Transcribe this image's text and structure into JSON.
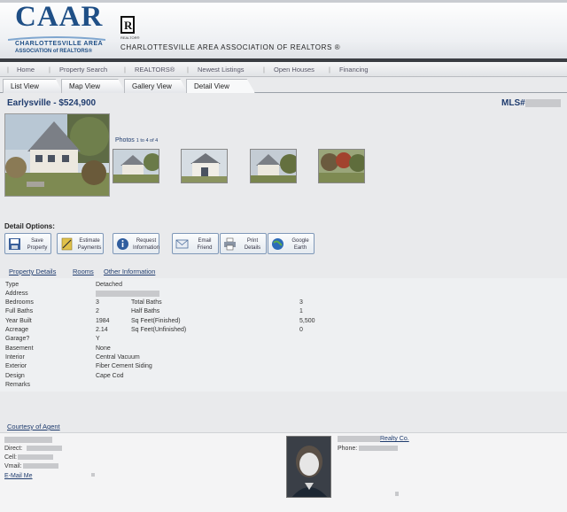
{
  "header": {
    "logo_text": "CAAR",
    "logo_line1": "CHARLOTTESVILLE AREA",
    "logo_line2": "ASSOCIATION of REALTORS®",
    "realtor_mark": "R",
    "realtor_small": "REALTOR®",
    "association_name": "CHARLOTTESVILLE AREA ASSOCIATION OF REALTORS ®"
  },
  "nav": {
    "items": [
      "Home",
      "Property Search",
      "REALTORS®",
      "Newest Listings",
      "Open Houses",
      "Financing"
    ]
  },
  "tabs": {
    "items": [
      "List View",
      "Map View",
      "Gallery View",
      "Detail View"
    ],
    "active": "Detail View"
  },
  "listing": {
    "title": "Earlysville - $524,900",
    "mls_label": "MLS#"
  },
  "photos": {
    "label": "Photos",
    "count_text": "1 to 4 of 4"
  },
  "detail_options": {
    "label": "Detail Options:",
    "buttons": [
      {
        "line1": "Save",
        "line2": "Property",
        "icon": "save-icon"
      },
      {
        "line1": "Estimate",
        "line2": "Payments",
        "icon": "calculator-icon"
      },
      {
        "line1": "Request",
        "line2": "Information",
        "icon": "info-icon"
      },
      {
        "line1": "Email",
        "line2": "Friend",
        "icon": "email-icon"
      },
      {
        "line1": "Print",
        "line2": "Details",
        "icon": "print-icon"
      },
      {
        "line1": "Google",
        "line2": "Earth",
        "icon": "globe-icon"
      }
    ]
  },
  "subtabs": [
    "Property Details",
    "Rooms",
    "Other Information"
  ],
  "details": {
    "type_label": "Type",
    "type_value": "Detached",
    "address_label": "Address",
    "bedrooms_label": "Bedrooms",
    "bedrooms_value": "3",
    "total_baths_label": "Total Baths",
    "total_baths_value": "3",
    "full_baths_label": "Full Baths",
    "full_baths_value": "2",
    "half_baths_label": "Half Baths",
    "half_baths_value": "1",
    "year_built_label": "Year Built",
    "year_built_value": "1984",
    "sqft_fin_label": "Sq Feet(Finished)",
    "sqft_fin_value": "5,500",
    "acreage_label": "Acreage",
    "acreage_value": "2.14",
    "sqft_unfin_label": "Sq Feet(Unfinished)",
    "sqft_unfin_value": "0",
    "garage_label": "Garage?",
    "garage_value": "Y",
    "basement_label": "Basement",
    "basement_value": "None",
    "interior_label": "Interior",
    "interior_value": "Central Vacuum",
    "exterior_label": "Exterior",
    "exterior_value": "Fiber Cement Siding",
    "design_label": "Design",
    "design_value": "Cape Cod",
    "remarks_label": "Remarks"
  },
  "courtesy": {
    "label": "Courtesy of Agent",
    "direct_label": "Direct:",
    "cell_label": "Cell:",
    "vmail_label": "Vmail:",
    "email_link": "E-Mail Me",
    "office_suffix": "Realty Co.",
    "phone_label": "Phone:"
  },
  "colors": {
    "brand_blue": "#1f4f86",
    "link_blue": "#1f3c6e",
    "redaction_gray": "#c8c9cc"
  }
}
